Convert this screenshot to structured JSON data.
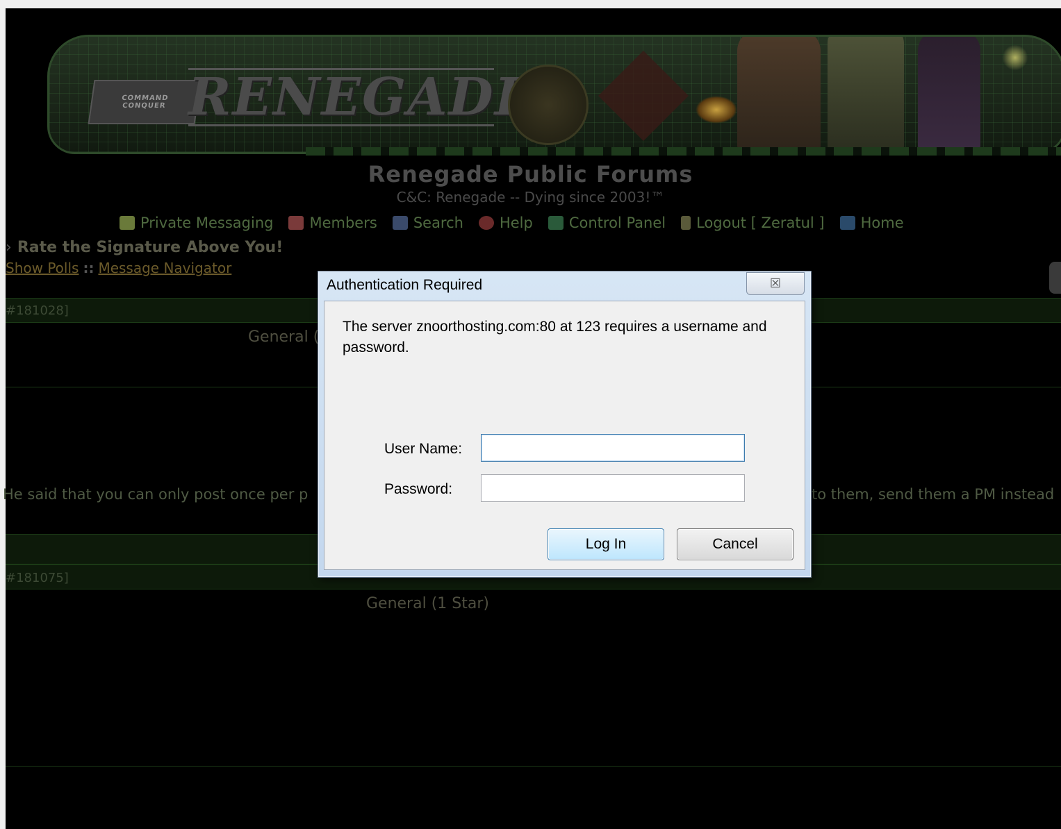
{
  "banner": {
    "badge_line1": "COMMAND",
    "badge_line2": "CONQUER",
    "logo": "RENEGADE"
  },
  "header": {
    "site_title": "Renegade Public Forums",
    "site_subtitle": "C&C: Renegade -- Dying since 2003!™"
  },
  "nav": {
    "items": [
      {
        "label": "Private Messaging",
        "icon": "envelope-icon",
        "color": "#6a7a3a"
      },
      {
        "label": "Members",
        "icon": "members-icon",
        "color": "#7a3a3a"
      },
      {
        "label": "Search",
        "icon": "search-icon",
        "color": "#3a4a6a"
      },
      {
        "label": "Help",
        "icon": "help-icon",
        "color": "#6a2a2a"
      },
      {
        "label": "Control Panel",
        "icon": "control-panel-icon",
        "color": "#2a5a3a"
      },
      {
        "label": "Logout [ Zeratul ]",
        "icon": "logout-icon",
        "color": "#5a5a3a"
      },
      {
        "label": "Home",
        "icon": "home-icon",
        "color": "#2a4a6a"
      }
    ]
  },
  "thread": {
    "title": "Rate the Signature Above You!",
    "show_polls": "Show Polls",
    "separator": "::",
    "message_navigator": "Message Navigator"
  },
  "posts": [
    {
      "id_label": "#181028]",
      "rank": "General (",
      "text_left": "He said that you can only post once per p",
      "text_right": "to them, send them a PM instead"
    },
    {
      "id_label": "#181075]",
      "rank": "General (1 Star)"
    }
  ],
  "dialog": {
    "title": "Authentication Required",
    "close_glyph": "☒",
    "message": "The server znoorthosting.com:80 at 123 requires a username and password.",
    "username_label": "User Name:",
    "username_value": "",
    "password_label": "Password:",
    "password_value": "",
    "login_label": "Log In",
    "cancel_label": "Cancel"
  }
}
